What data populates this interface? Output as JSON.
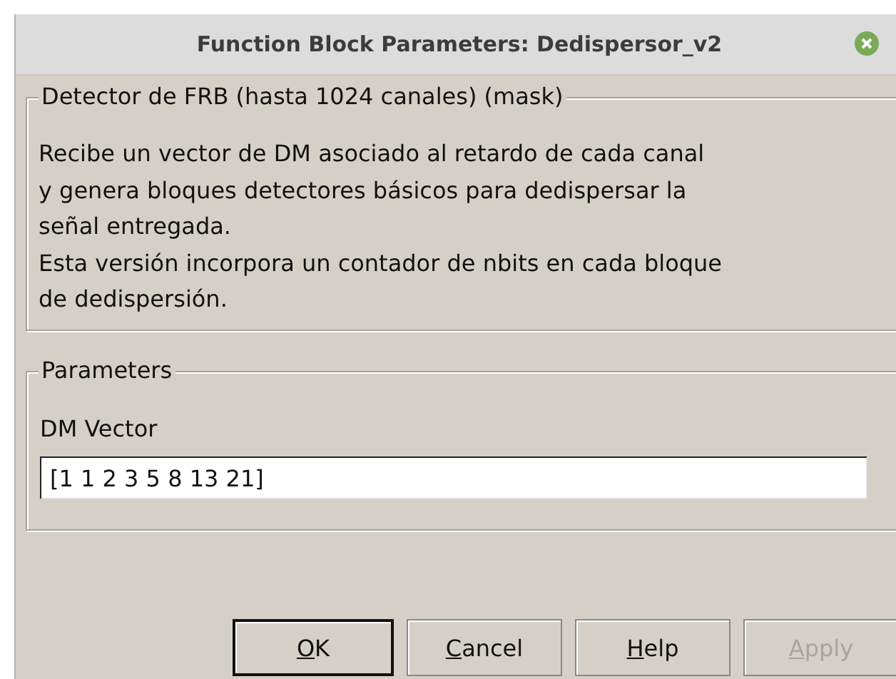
{
  "window": {
    "title": "Function Block Parameters: Dedispersor_v2"
  },
  "description_group": {
    "title": "Detector de FRB (hasta 1024 canales) (mask)",
    "lines": [
      "Recibe un vector de DM asociado al retardo de cada canal",
      "y genera bloques detectores básicos para dedispersar la",
      "señal entregada.",
      "Esta versión incorpora un contador de nbits en cada bloque",
      "de dedispersión."
    ]
  },
  "parameters_group": {
    "title": "Parameters",
    "fields": [
      {
        "label": "DM Vector",
        "value": "[1 1 2 3 5 8 13 21]"
      }
    ]
  },
  "buttons": [
    {
      "label": "OK",
      "default": true,
      "disabled": false
    },
    {
      "label": "Cancel",
      "default": false,
      "disabled": false
    },
    {
      "label": "Help",
      "default": false,
      "disabled": false
    },
    {
      "label": "Apply",
      "default": false,
      "disabled": true
    }
  ]
}
